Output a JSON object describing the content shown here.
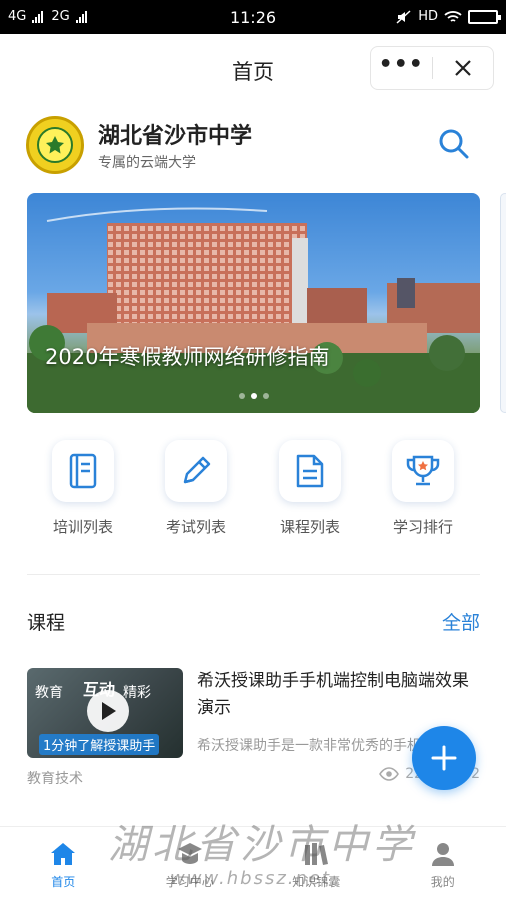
{
  "statusbar": {
    "net1": "4G",
    "net2": "2G",
    "time": "11:26",
    "hd": "HD"
  },
  "navbar": {
    "title": "首页"
  },
  "school": {
    "name": "湖北省沙市中学",
    "subtitle": "专属的云端大学"
  },
  "banner": {
    "caption": "2020年寒假教师网络研修指南",
    "slides": 3,
    "active_slide": 1
  },
  "quick_actions": [
    {
      "label": "培训列表",
      "icon": "document-list-icon"
    },
    {
      "label": "考试列表",
      "icon": "pencil-icon"
    },
    {
      "label": "课程列表",
      "icon": "file-icon"
    },
    {
      "label": "学习排行",
      "icon": "trophy-icon"
    }
  ],
  "courses_section": {
    "title": "课程",
    "more": "全部"
  },
  "course": {
    "title": "希沃授课助手手机端控制电脑端效果演示",
    "description": "希沃授课助手是一款非常优秀的手机",
    "tag": "教育技术",
    "views": "22",
    "likes": "2",
    "thumb_text_1": "教育",
    "thumb_text_2": "互动",
    "thumb_text_3": "精彩",
    "thumb_caption": "1分钟了解授课助手"
  },
  "tabbar": [
    {
      "label": "首页",
      "icon": "home-icon",
      "active": true
    },
    {
      "label": "学习中心",
      "icon": "book-icon",
      "active": false
    },
    {
      "label": "知识锦囊",
      "icon": "library-icon",
      "active": false
    },
    {
      "label": "我的",
      "icon": "user-icon",
      "active": false
    }
  ],
  "watermark": {
    "text": "湖北省沙市中学",
    "url": "www.hbssz.net"
  },
  "colors": {
    "accent": "#1e86e8",
    "text": "#222222",
    "muted": "#999999"
  }
}
